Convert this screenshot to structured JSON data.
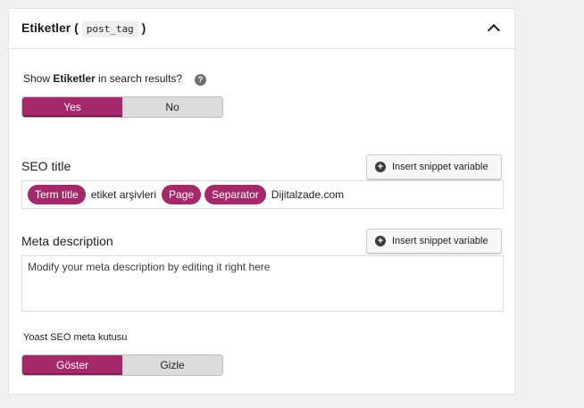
{
  "panel": {
    "title": "Etiketler (",
    "title_code": "post_tag",
    "title_end": ")"
  },
  "search_results": {
    "label_prefix": "Show ",
    "label_bold": "Etiketler",
    "label_suffix": " in search results?",
    "help_icon": "?",
    "options": [
      "Yes",
      "No"
    ],
    "selected": "Yes"
  },
  "seo_title": {
    "label": "SEO title",
    "snippet_button": "Insert snippet variable",
    "tokens": [
      {
        "type": "pill",
        "text": "Term title"
      },
      {
        "type": "text",
        "text": "etiket arşivleri"
      },
      {
        "type": "pill",
        "text": "Page"
      },
      {
        "type": "pill",
        "text": "Separator"
      },
      {
        "type": "text",
        "text": "Dijitalzade.com"
      }
    ]
  },
  "meta_description": {
    "label": "Meta description",
    "snippet_button": "Insert snippet variable",
    "placeholder": "Modify your meta description by editing it right here"
  },
  "meta_box": {
    "label": "Yoast SEO meta kutusu",
    "options": [
      "Göster",
      "Gizle"
    ],
    "selected": "Göster"
  },
  "colors": {
    "accent": "#a4286a",
    "background": "#f1f1f1"
  }
}
